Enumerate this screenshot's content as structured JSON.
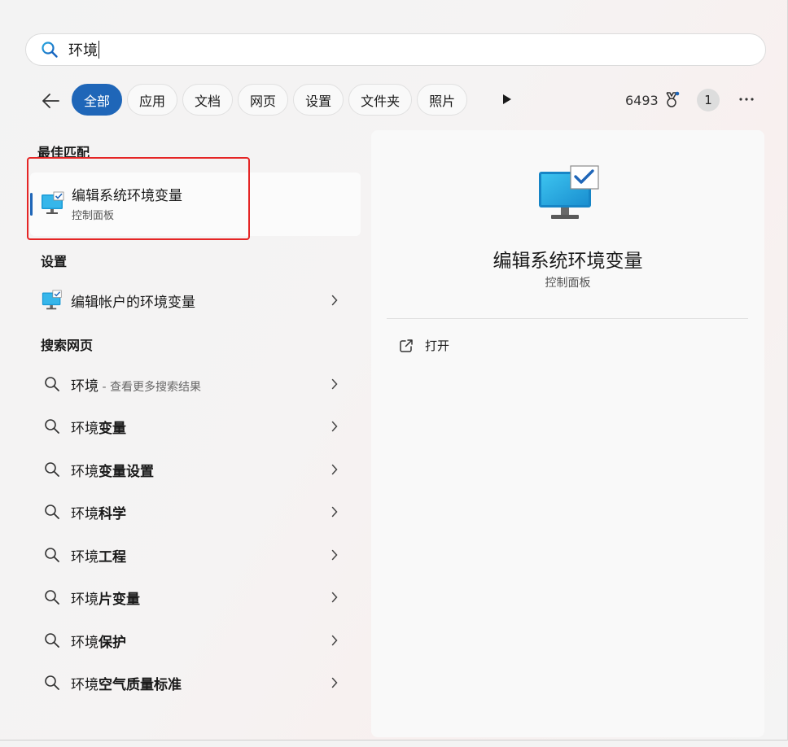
{
  "search": {
    "value": "环境"
  },
  "filters": {
    "chips": [
      "全部",
      "应用",
      "文档",
      "网页",
      "设置",
      "文件夹",
      "照片"
    ],
    "active_index": 0,
    "points": "6493",
    "badge_count": "1"
  },
  "best_match": {
    "heading": "最佳匹配",
    "title": "编辑系统环境变量",
    "subtitle": "控制面板"
  },
  "settings": {
    "heading": "设置",
    "item": "编辑帐户的环境变量"
  },
  "web": {
    "heading": "搜索网页",
    "first": {
      "prefix": "环境",
      "hint": " - 查看更多搜索结果"
    },
    "items": [
      {
        "prefix": "环境",
        "bold": "变量"
      },
      {
        "prefix": "环境",
        "bold": "变量设置"
      },
      {
        "prefix": "环境",
        "bold": "科学"
      },
      {
        "prefix": "环境",
        "bold": "工程"
      },
      {
        "prefix": "环境",
        "bold": "片变量"
      },
      {
        "prefix": "环境",
        "bold": "保护"
      },
      {
        "prefix": "环境",
        "bold": "空气质量标准"
      }
    ]
  },
  "detail": {
    "title": "编辑系统环境变量",
    "subtitle": "控制面板",
    "actions": {
      "open": "打开"
    }
  },
  "colors": {
    "accent": "#1f66b8",
    "highlight": "#e52525"
  }
}
